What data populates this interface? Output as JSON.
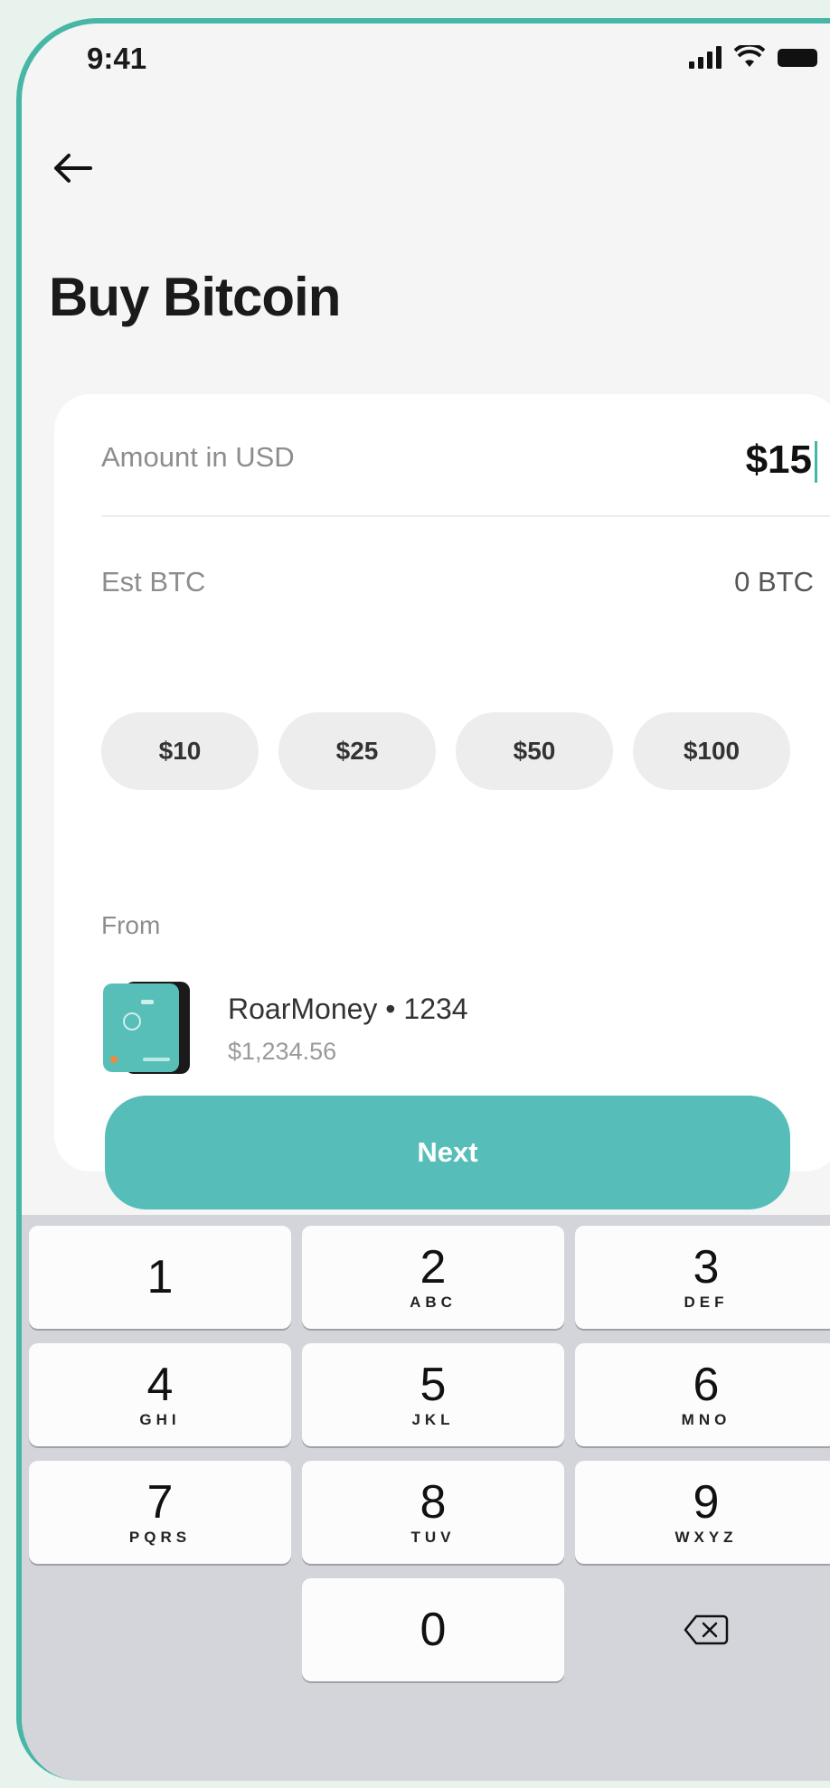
{
  "status_bar": {
    "time": "9:41"
  },
  "header": {
    "title": "Buy Bitcoin"
  },
  "amount": {
    "label": "Amount in USD",
    "value": "$15"
  },
  "estimate": {
    "label": "Est BTC",
    "value": "0 BTC"
  },
  "quick_amounts": [
    "$10",
    "$25",
    "$50",
    "$100"
  ],
  "from": {
    "label": "From",
    "account_name": "RoarMoney • 1234",
    "balance": "$1,234.56"
  },
  "next_button": {
    "label": "Next"
  },
  "keypad": {
    "keys": [
      {
        "num": "1",
        "letters": ""
      },
      {
        "num": "2",
        "letters": "ABC"
      },
      {
        "num": "3",
        "letters": "DEF"
      },
      {
        "num": "4",
        "letters": "GHI"
      },
      {
        "num": "5",
        "letters": "JKL"
      },
      {
        "num": "6",
        "letters": "MNO"
      },
      {
        "num": "7",
        "letters": "PQRS"
      },
      {
        "num": "8",
        "letters": "TUV"
      },
      {
        "num": "9",
        "letters": "WXYZ"
      },
      {
        "num": "0",
        "letters": ""
      }
    ]
  },
  "colors": {
    "accent": "#56bdb9",
    "frame": "#48b6a7"
  }
}
